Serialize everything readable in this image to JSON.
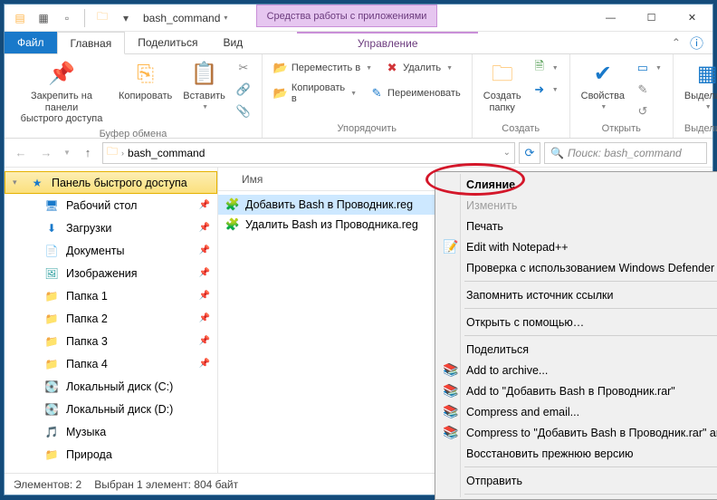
{
  "title": "bash_command",
  "contextual_tab_group": "Средства работы с приложениями",
  "tabs": {
    "file": "Файл",
    "home": "Главная",
    "share": "Поделиться",
    "view": "Вид",
    "manage": "Управление"
  },
  "ribbon": {
    "clipboard": {
      "label": "Буфер обмена",
      "pin": "Закрепить на панели\nбыстрого доступа",
      "copy": "Копировать",
      "paste": "Вставить"
    },
    "organize": {
      "label": "Упорядочить",
      "move": "Переместить в",
      "copy_to": "Копировать в",
      "delete": "Удалить",
      "rename": "Переименовать"
    },
    "new": {
      "label": "Создать",
      "folder": "Создать\nпапку"
    },
    "open": {
      "label": "Открыть",
      "props": "Свойства"
    },
    "select": {
      "label": "Выделить",
      "all": "Выделить"
    }
  },
  "addressbar": {
    "folder": "bash_command"
  },
  "search_placeholder": "Поиск: bash_command",
  "nav": {
    "quick": "Панель быстрого доступа",
    "items": [
      {
        "label": "Рабочий стол",
        "pin": true,
        "icon": "🖥",
        "cls": "c-blue"
      },
      {
        "label": "Загрузки",
        "pin": true,
        "icon": "⬇",
        "cls": "c-blue"
      },
      {
        "label": "Документы",
        "pin": true,
        "icon": "📄",
        "cls": "c-teal"
      },
      {
        "label": "Изображения",
        "pin": true,
        "icon": "🖼",
        "cls": "c-teal"
      },
      {
        "label": "Папка 1",
        "pin": true,
        "icon": "📁",
        "cls": "c-orange"
      },
      {
        "label": "Папка 2",
        "pin": true,
        "icon": "📁",
        "cls": "c-orange"
      },
      {
        "label": "Папка 3",
        "pin": true,
        "icon": "📁",
        "cls": "c-orange"
      },
      {
        "label": "Папка 4",
        "pin": true,
        "icon": "📁",
        "cls": "c-orange"
      },
      {
        "label": "Локальный диск (C:)",
        "pin": false,
        "icon": "💽",
        "cls": "c-gray"
      },
      {
        "label": "Локальный диск (D:)",
        "pin": false,
        "icon": "💽",
        "cls": "c-gray"
      },
      {
        "label": "Музыка",
        "pin": false,
        "icon": "🎵",
        "cls": "c-purple"
      },
      {
        "label": "Природа",
        "pin": false,
        "icon": "📁",
        "cls": "c-orange"
      }
    ]
  },
  "columns": {
    "name": "Имя"
  },
  "files": [
    {
      "name": "Добавить Bash в Проводник.reg",
      "sel": true
    },
    {
      "name": "Удалить Bash из Проводника.reg",
      "sel": false
    }
  ],
  "context_menu": [
    {
      "label": "Слияние",
      "bold": true
    },
    {
      "label": "Изменить",
      "disabled": true
    },
    {
      "label": "Печать"
    },
    {
      "label": "Edit with Notepad++",
      "icon": "📝"
    },
    {
      "label": "Проверка с использованием Windows Defender"
    },
    {
      "sep": true
    },
    {
      "label": "Запомнить источник ссылки"
    },
    {
      "sep": true
    },
    {
      "label": "Открыть с помощью…",
      "sub": true
    },
    {
      "sep": true
    },
    {
      "label": "Поделиться"
    },
    {
      "label": "Add to archive...",
      "icon": "📚"
    },
    {
      "label": "Add to \"Добавить Bash в Проводник.rar\"",
      "icon": "📚"
    },
    {
      "label": "Compress and email...",
      "icon": "📚"
    },
    {
      "label": "Compress to \"Добавить Bash в Проводник.rar\" and ema",
      "icon": "📚"
    },
    {
      "label": "Восстановить прежнюю версию"
    },
    {
      "sep": true
    },
    {
      "label": "Отправить",
      "sub": true
    },
    {
      "sep": true
    }
  ],
  "status": {
    "count": "Элементов: 2",
    "selection": "Выбран 1 элемент: 804 байт"
  }
}
